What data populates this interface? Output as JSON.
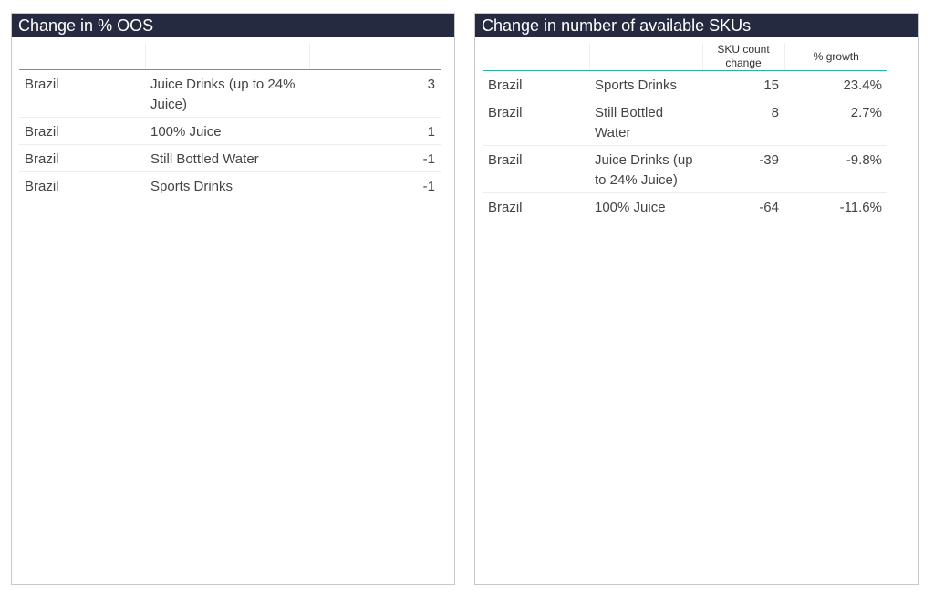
{
  "left_panel": {
    "title": "Change in % OOS",
    "headers": [
      "",
      "",
      ""
    ],
    "rows": [
      {
        "country": "Brazil",
        "category": "Juice Drinks (up to 24% Juice)",
        "value": "3"
      },
      {
        "country": "Brazil",
        "category": "100% Juice",
        "value": "1"
      },
      {
        "country": "Brazil",
        "category": "Still Bottled Water",
        "value": "-1"
      },
      {
        "country": "Brazil",
        "category": "Sports Drinks",
        "value": "-1"
      }
    ]
  },
  "right_panel": {
    "title": "Change in number of available SKUs",
    "headers": [
      "",
      "",
      "SKU count change",
      "% growth"
    ],
    "rows": [
      {
        "country": "Brazil",
        "category": "Sports Drinks",
        "sku_change": "15",
        "growth": "23.4%"
      },
      {
        "country": "Brazil",
        "category": "Still Bottled Water",
        "sku_change": "8",
        "growth": "2.7%"
      },
      {
        "country": "Brazil",
        "category": "Juice Drinks (up to 24% Juice)",
        "sku_change": "-39",
        "growth": "-9.8%"
      },
      {
        "country": "Brazil",
        "category": "100% Juice",
        "sku_change": "-64",
        "growth": "-11.6%"
      }
    ]
  },
  "colors": {
    "header_bg": "#252a40",
    "header_text": "#ffffff",
    "accent_rule": "#2bb3a0",
    "body_text": "#444444"
  }
}
